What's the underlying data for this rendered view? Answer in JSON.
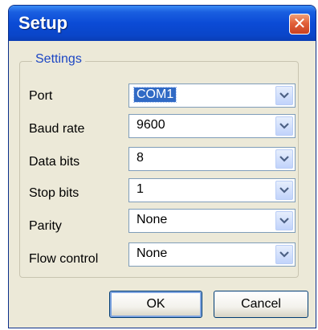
{
  "window": {
    "title": "Setup",
    "close_glyph": "✕"
  },
  "settings": {
    "group_label": "Settings",
    "rows": [
      {
        "label": "Port",
        "value": "COM1"
      },
      {
        "label": "Baud rate",
        "value": "9600"
      },
      {
        "label": "Data bits",
        "value": "8"
      },
      {
        "label": "Stop bits",
        "value": "1"
      },
      {
        "label": "Parity",
        "value": "None"
      },
      {
        "label": "Flow control",
        "value": "None"
      }
    ]
  },
  "buttons": {
    "ok_label": "OK",
    "cancel_label": "Cancel"
  },
  "icons": {
    "dropdown": "chevron-down-icon",
    "close": "close-icon"
  },
  "colors": {
    "titlebar": "#0b4bd6",
    "group_label": "#1c46c4",
    "selection": "#316ac5",
    "close_button": "#e2603a"
  }
}
